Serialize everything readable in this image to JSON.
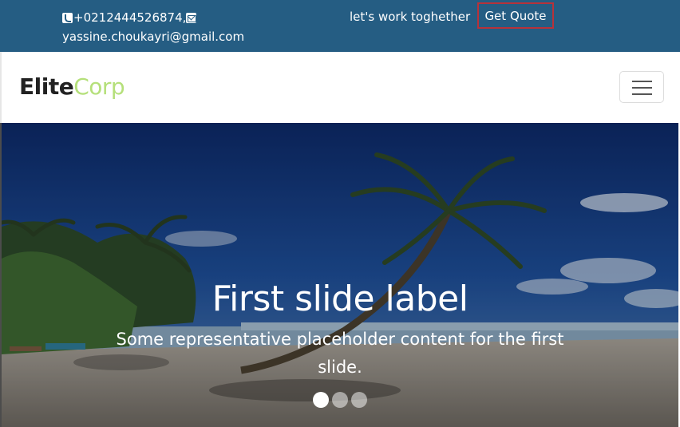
{
  "topbar": {
    "phone": "+0212444526874,",
    "email": "yassine.choukayri@gmail.com",
    "tagline": "let's work toghether",
    "quote_label": "Get Quote"
  },
  "navbar": {
    "brand_part1": "Elite",
    "brand_part2": "Corp",
    "toggler_icon": "hamburger-icon"
  },
  "carousel": {
    "slide_title": "First slide label",
    "slide_text": "Some representative placeholder content for the first slide.",
    "indicator_count": 3,
    "active_index": 0
  },
  "colors": {
    "topbar_bg": "#255d83",
    "quote_border": "#b7323a",
    "brand_accent": "#b5e07a"
  }
}
